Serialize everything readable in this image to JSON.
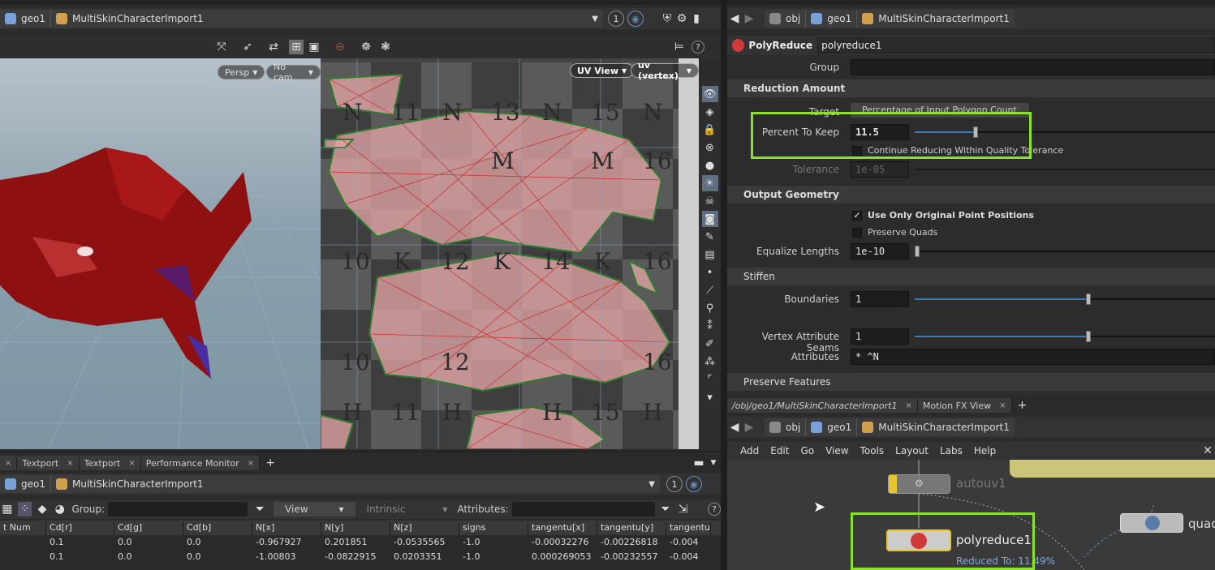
{
  "viewer": {
    "path": [
      "geo1",
      "MultiSkinCharacterImport1"
    ],
    "frame_indicator": "1",
    "persp_label": "Persp",
    "cam_label": "No cam",
    "uv_view_label": "UV View",
    "uv_attr_label": "uv (vertex)",
    "uv_grid_letters": [
      "N",
      "11",
      "N",
      "13",
      "N",
      "15",
      "N",
      "M",
      "M",
      "16",
      "10",
      "K",
      "12",
      "K",
      "14",
      "K",
      "16",
      "10",
      "12",
      "16",
      "H",
      "11",
      "H",
      "H",
      "15",
      "H"
    ]
  },
  "bottom_tabs": [
    "Textport",
    "Textport",
    "Performance Monitor"
  ],
  "spreadsheet": {
    "path": [
      "geo1",
      "MultiSkinCharacterImport1"
    ],
    "frame_indicator": "1",
    "group_label": "Group:",
    "view_label": "View",
    "intrinsics_label": "Intrinsic",
    "attributes_label": "Attributes:",
    "columns": [
      "t Num",
      "Cd[r]",
      "Cd[g]",
      "Cd[b]",
      "N[x]",
      "N[y]",
      "N[z]",
      "signs",
      "tangentu[x]",
      "tangentu[y]",
      "tangentu"
    ],
    "rows": [
      [
        "",
        "0.1",
        "0.0",
        "0.0",
        "-0.967927",
        "0.201851",
        "-0.0535565",
        "-1.0",
        "-0.00032276",
        "-0.00226818",
        "-0.004"
      ],
      [
        "",
        "0.1",
        "0.0",
        "0.0",
        "-1.00803",
        "-0.0822915",
        "0.0203351",
        "-1.0",
        "0.000269053",
        "-0.00232557",
        "-0.004"
      ]
    ]
  },
  "params": {
    "path": [
      "obj",
      "geo1",
      "MultiSkinCharacterImport1"
    ],
    "node_type": "PolyReduce",
    "node_name": "polyreduce1",
    "group_label": "Group",
    "reduction_section": "Reduction Amount",
    "target_label": "Target",
    "target_value": "Percentage of Input Polygon Count",
    "percent_label": "Percent To Keep",
    "percent_value": "11.5",
    "percent_fraction": 0.115,
    "continue_label": "Continue Reducing Within Quality Tolerance",
    "tolerance_label": "Tolerance",
    "tolerance_value": "1e-05",
    "output_section": "Output Geometry",
    "use_original_label": "Use Only Original Point Positions",
    "preserve_quads_label": "Preserve Quads",
    "equalize_label": "Equalize Lengths",
    "equalize_value": "1e-10",
    "stiffen_section": "Stiffen",
    "boundaries_label": "Boundaries",
    "boundaries_value": "1",
    "seams_label": "Vertex Attribute Seams",
    "seams_value": "1",
    "attributes_label": "Attributes",
    "attributes_value": "* ^N",
    "preserve_section": "Preserve Features"
  },
  "network": {
    "tabs": [
      "/obj/geo1/MultiSkinCharacterImport1",
      "Motion FX View"
    ],
    "path": [
      "obj",
      "geo1",
      "MultiSkinCharacterImport1"
    ],
    "menu": [
      "Add",
      "Edit",
      "Go",
      "View",
      "Tools",
      "Layout",
      "Labs",
      "Help"
    ],
    "node_autouv": "autouv1",
    "node_polyreduce": "polyreduce1",
    "node_quad": "quad",
    "reduced_label": "Reduced To: 11.49%"
  }
}
